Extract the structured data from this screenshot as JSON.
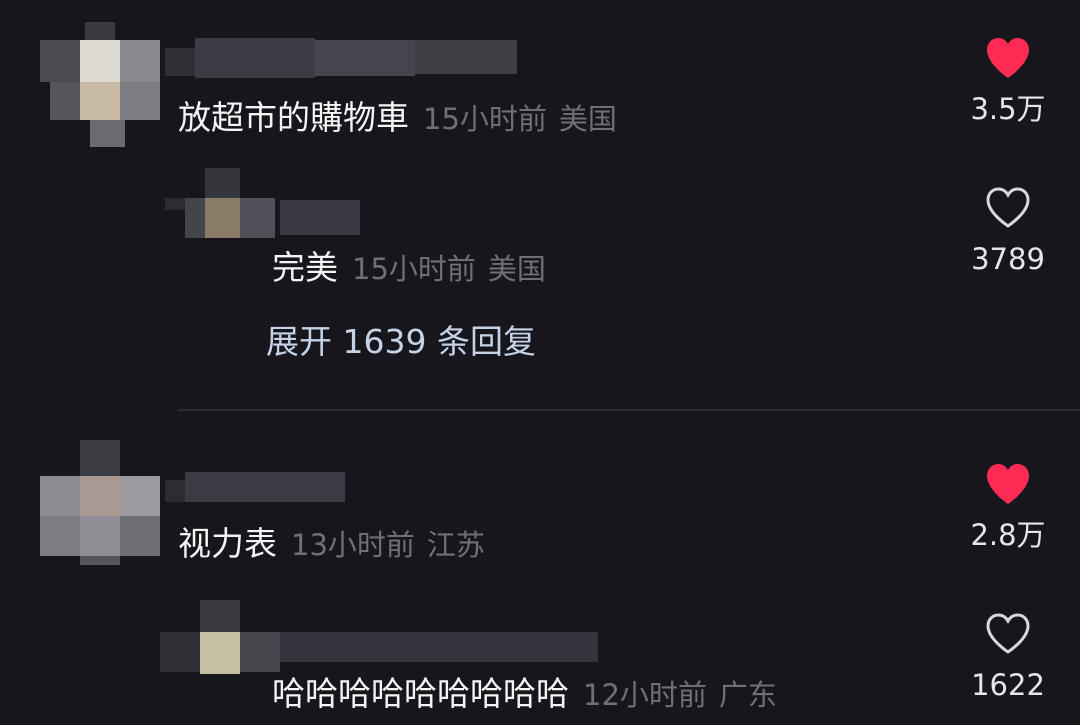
{
  "colors": {
    "background": "#16161c",
    "liked_heart": "#fe2c55",
    "unliked_heart": "#d8d8d8",
    "meta_text": "#6f6f76",
    "expand_link": "#c6d3e6"
  },
  "comments": [
    {
      "text": "放超市的購物車",
      "time": "15小时前",
      "location": "美国",
      "likes": "3.5万",
      "liked": true,
      "avatar_icon": "pixelated-avatar",
      "username_icon": "pixelated-username",
      "reply": {
        "text": "完美",
        "time": "15小时前",
        "location": "美国",
        "likes": "3789",
        "liked": false,
        "avatar_icon": "pixelated-avatar",
        "username_icon": "pixelated-username"
      },
      "expand_label": "展开 1639 条回复"
    },
    {
      "text": "视力表",
      "time": "13小时前",
      "location": "江苏",
      "likes": "2.8万",
      "liked": true,
      "avatar_icon": "pixelated-avatar",
      "username_icon": "pixelated-username",
      "reply": {
        "text": "哈哈哈哈哈哈哈哈哈",
        "time": "12小时前",
        "location": "广东",
        "likes": "1622",
        "liked": false,
        "avatar_icon": "pixelated-avatar",
        "username_icon": "pixelated-username"
      }
    }
  ]
}
